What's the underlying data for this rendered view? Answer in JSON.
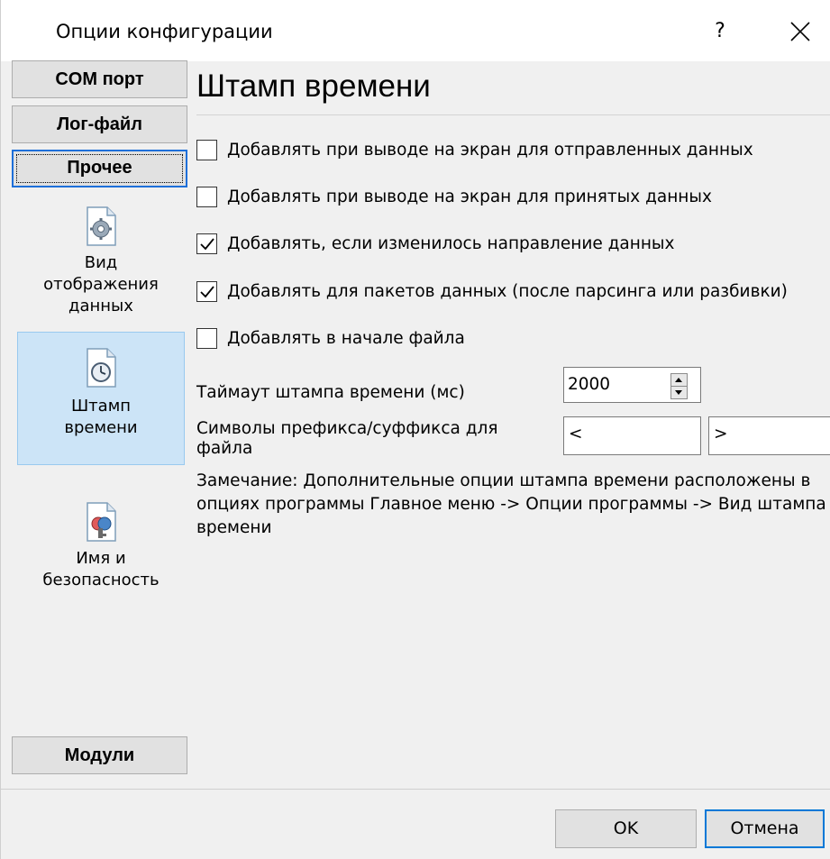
{
  "window": {
    "title": "Опции конфигурации",
    "help_label": "?"
  },
  "nav": {
    "buttons": [
      {
        "label": "COM порт"
      },
      {
        "label": "Лог-файл"
      },
      {
        "label": "Прочее"
      }
    ],
    "items": [
      {
        "label": "Вид отображения данных",
        "icon": "gear-document-icon"
      },
      {
        "label": "Штамп времени",
        "icon": "clock-document-icon"
      },
      {
        "label": "Имя и безопасность",
        "icon": "key-document-icon"
      }
    ],
    "modules_label": "Модули"
  },
  "content": {
    "title": "Штамп времени",
    "checkboxes": [
      {
        "label": "Добавлять при выводе на экран для отправленных данных",
        "checked": false
      },
      {
        "label": "Добавлять при выводе на экран для принятых данных",
        "checked": false
      },
      {
        "label": "Добавлять, если изменилось направление данных",
        "checked": true
      },
      {
        "label": "Добавлять для пакетов данных (после парсинга или разбивки)",
        "checked": true
      },
      {
        "label": "Добавлять в начале файла",
        "checked": false
      }
    ],
    "timeout": {
      "label": "Таймаут штампа времени (мс)",
      "value": "2000"
    },
    "prefix_suffix": {
      "label": "Символы префикса/суффикса для файла",
      "prefix": "<",
      "suffix": ">"
    },
    "note": "Замечание: Дополнительные опции штампа времени расположены в опциях программы Главное меню -> Опции программы -> Вид штампа времени"
  },
  "footer": {
    "ok_label": "OK",
    "cancel_label": "Отмена"
  }
}
